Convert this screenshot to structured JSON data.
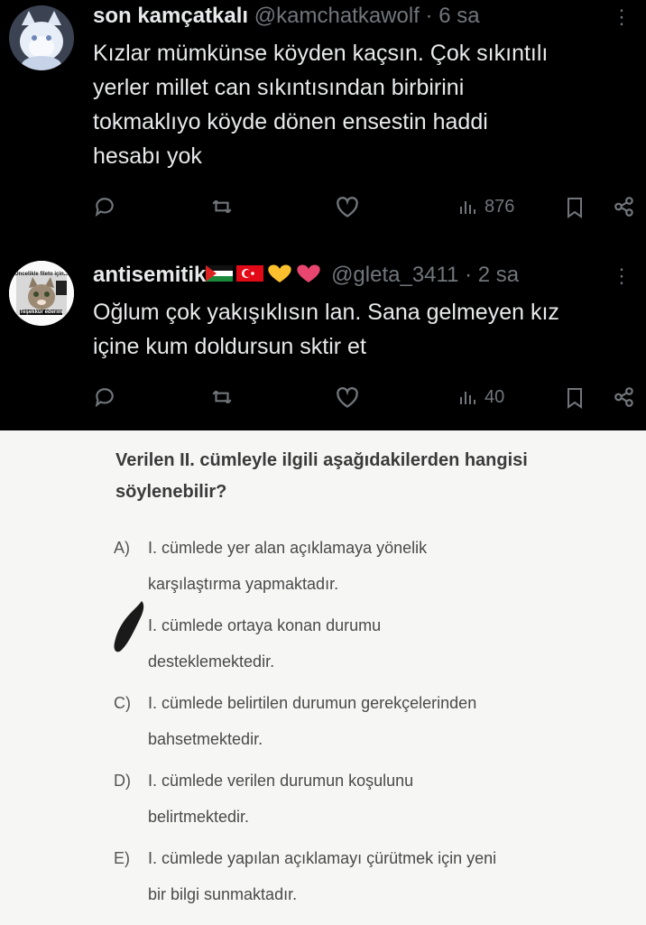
{
  "tweets": [
    {
      "name": "son kamçatkalı",
      "handle": "@kamchatkawolf",
      "time": "· 6 sa",
      "more": "⋮",
      "text": [
        "Kızlar mümkünse köyden kaçsın. Çok sıkıntılı",
        "yerler millet can sıkıntısından birbirini",
        "tokmaklıyo köyde dönen ensestin haddi",
        "hesabı yok"
      ],
      "views": "876"
    },
    {
      "name": "antisemitik",
      "emoji_flags": [
        "palestine-flag",
        "turkey-flag",
        "yellow-heart",
        "pink-heart"
      ],
      "handle": "@gleta_3411",
      "time": "· 2 sa",
      "more": "⋮",
      "text": [
        "Oğlum çok yakışıklısın lan. Sana gelmeyen kız",
        "içine kum doldursun sktir et"
      ],
      "views": "40",
      "avatar_text": [
        "Öncelikle fileto için...",
        "Teşekkür ederim"
      ]
    }
  ],
  "paper": {
    "question": [
      "Verilen II. cümleyle ilgili aşağıdakilerden hangisi",
      "söylenebilir?"
    ],
    "options": [
      {
        "letter": "A)",
        "lines": [
          "I. cümlede yer alan açıklamaya yönelik",
          "karşılaştırma yapmaktadır."
        ]
      },
      {
        "letter": "",
        "lines": [
          "I. cümlede ortaya konan durumu",
          "desteklemektedir."
        ]
      },
      {
        "letter": "C)",
        "lines": [
          "I. cümlede belirtilen durumun gerekçelerinden",
          "bahsetmektedir."
        ]
      },
      {
        "letter": "D)",
        "lines": [
          "I. cümlede verilen durumun koşulunu",
          "belirtmektedir."
        ]
      },
      {
        "letter": "E)",
        "lines": [
          "I. cümlede yapılan açıklamayı çürütmek için yeni",
          "bir bilgi sunmaktadır."
        ]
      }
    ]
  },
  "colors": {
    "bg": "#000000",
    "text": "#e7e9ea",
    "muted": "#71767b",
    "paper": "#f6f6f4",
    "pen": "#1a1a1a"
  }
}
